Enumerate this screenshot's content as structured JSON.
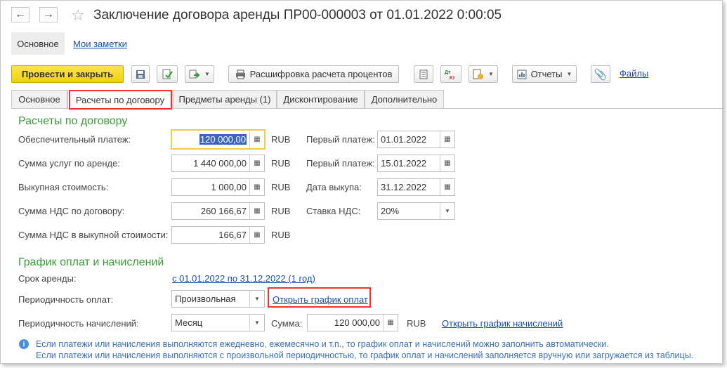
{
  "window": {
    "title": "Заключение договора аренды ПР00-000003 от 01.01.2022 0:00:05"
  },
  "top_nav": {
    "main_label": "Основное",
    "notes_label": "Мои заметки"
  },
  "toolbar": {
    "post_close": "Провести и закрыть",
    "decode": "Расшифровка расчета процентов",
    "reports": "Отчеты",
    "files": "Файлы"
  },
  "tabs": [
    {
      "label": "Основное"
    },
    {
      "label": "Расчеты по договору"
    },
    {
      "label": "Предметы аренды (1)"
    },
    {
      "label": "Дисконтирование"
    },
    {
      "label": "Дополнительно"
    }
  ],
  "settlements": {
    "heading": "Расчеты по договору",
    "rows": [
      {
        "label": "Обеспечительный платеж:",
        "value": "120 000,00",
        "currency": "RUB"
      },
      {
        "label": "Сумма услуг по аренде:",
        "value": "1 440 000,00",
        "currency": "RUB"
      },
      {
        "label": "Выкупная стоимость:",
        "value": "1 000,00",
        "currency": "RUB"
      },
      {
        "label": "Сумма НДС по договору:",
        "value": "260 166,67",
        "currency": "RUB"
      },
      {
        "label": "Сумма НДС в выкупной стоимости:",
        "value": "166,67",
        "currency": "RUB"
      }
    ],
    "right": [
      {
        "label": "Первый платеж:",
        "value": "01.01.2022"
      },
      {
        "label": "Первый платеж:",
        "value": "15.01.2022"
      },
      {
        "label": "Дата выкупа:",
        "value": "31.12.2022"
      },
      {
        "label": "Ставка НДС:",
        "value": "20%"
      }
    ]
  },
  "schedule": {
    "heading": "График оплат и начислений",
    "term_label": "Срок аренды:",
    "term_value": "с 01.01.2022 по 31.12.2022 (1 год)",
    "pay_period_label": "Периодичность оплат:",
    "pay_period_value": "Произвольная",
    "open_pay_schedule": "Открыть график оплат",
    "accrual_period_label": "Периодичность начислений:",
    "accrual_period_value": "Месяц",
    "sum_label": "Сумма:",
    "sum_value": "120 000,00",
    "sum_currency": "RUB",
    "open_accrual_schedule": "Открыть график начислений"
  },
  "info": {
    "line1": "Если платежи или начисления выполняются ежедневно, ежемесячно и т.п., то график оплат и начислений можно заполнить автоматически.",
    "line2": "Если платежи или начисления выполняются с произвольной периодичностью, то график оплат и начислений заполняется вручную или загружается из таблицы."
  },
  "colors": {
    "accent_green": "#3a9a3a",
    "link_blue": "#1a4fa0",
    "primary_yellow": "#f2cf10",
    "highlight_red": "#e33333"
  }
}
